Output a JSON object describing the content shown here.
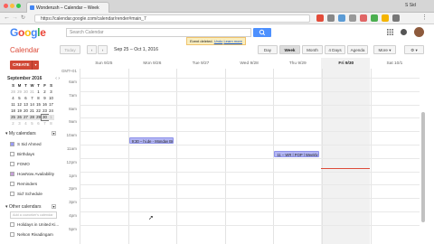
{
  "browser": {
    "tab_title": "Wonderush – Calendar – Week",
    "url": "https://calendar.google.com/calendar/render#main_7",
    "user": "S Sid"
  },
  "header": {
    "logo": "Google",
    "search_placeholder": "Search Calendar"
  },
  "nav": {
    "app_label": "Calendar",
    "today_label": "Today",
    "date_range": "Sep 25 – Oct 1, 2016",
    "views": [
      "Day",
      "Week",
      "Month",
      "4 Days",
      "Agenda"
    ],
    "active_view": "Week",
    "more_label": "More",
    "toast": {
      "text": "Event deleted",
      "undo": "Undo",
      "learn": "Learn more"
    }
  },
  "sidebar": {
    "create_label": "CREATE",
    "mini_cal": {
      "title": "September 2016",
      "weekdays": [
        "S",
        "M",
        "T",
        "W",
        "T",
        "F",
        "S"
      ],
      "weeks": [
        [
          "28",
          "29",
          "30",
          "31",
          "1",
          "2",
          "3"
        ],
        [
          "4",
          "5",
          "6",
          "7",
          "8",
          "9",
          "10"
        ],
        [
          "11",
          "12",
          "13",
          "14",
          "15",
          "16",
          "17"
        ],
        [
          "18",
          "19",
          "20",
          "21",
          "22",
          "23",
          "24"
        ],
        [
          "25",
          "26",
          "27",
          "28",
          "29",
          "30",
          "1"
        ],
        [
          "2",
          "3",
          "4",
          "5",
          "6",
          "7",
          "8"
        ]
      ]
    },
    "my_calendars_label": "My calendars",
    "my_calendars": [
      {
        "name": "S Sid Ahmed",
        "color": "#9a9cff"
      },
      {
        "name": "Birthdays",
        "color": "#ffffff"
      },
      {
        "name": "FOMO",
        "color": "#ffffff"
      },
      {
        "name": "HowNow Availability",
        "color": "#c6a0d8"
      },
      {
        "name": "Reminders",
        "color": "#ffffff"
      },
      {
        "name": "Sid' Schedule",
        "color": "#ffffff"
      }
    ],
    "other_calendars_label": "Other calendars",
    "add_friend_placeholder": "Add a coworker's calendar",
    "other_calendars": [
      {
        "name": "Holidays in United Ki..."
      },
      {
        "name": "Nelson Rivadingam"
      }
    ]
  },
  "week": {
    "gmt_label": "GMT+01",
    "days": [
      "Sun 9/25",
      "Mon 9/26",
      "Tue 9/27",
      "Wed 9/28",
      "Thu 9/29",
      "Fri 9/30",
      "Sat 10/1"
    ],
    "today_index": 5,
    "hours": [
      "6am",
      "7am",
      "8am",
      "9am",
      "10am",
      "11am",
      "12pm",
      "1pm",
      "2pm",
      "3pm",
      "4pm",
      "5pm"
    ],
    "events": [
      {
        "day": 1,
        "text": "9:30 – hi.de - Monday Brief",
        "color": "#b3b6f5",
        "hour": 10.0
      },
      {
        "day": 4,
        "text": "11 – WR | POP | Weekly R...",
        "color": "#b3b6f5",
        "hour": 11.0
      }
    ]
  },
  "colors": {
    "accent": "#dd4b39",
    "brand_blue": "#4d90fe",
    "event": "#b3b6f5"
  }
}
